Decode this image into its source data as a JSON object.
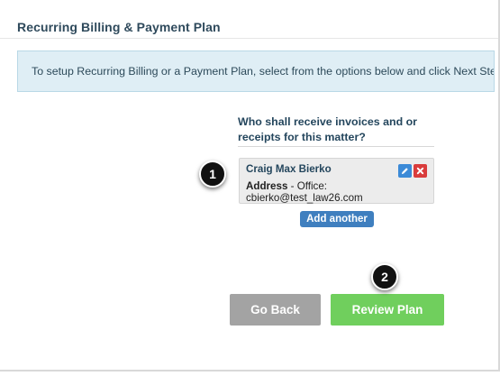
{
  "page": {
    "title": "Recurring Billing & Payment Plan",
    "instructions": "To setup Recurring Billing or a Payment Plan, select from the options below and click Next Step."
  },
  "recipients": {
    "heading": "Who shall receive invoices and or receipts for this matter?",
    "contacts": [
      {
        "name": "Craig Max Bierko",
        "address_label": "Address",
        "address_value": " - Office:",
        "email": "cbierko@test_law26.com",
        "edit_icon": "pencil-icon",
        "delete_icon": "close-icon"
      }
    ],
    "add_label": "Add another"
  },
  "actions": {
    "back_label": "Go Back",
    "review_label": "Review Plan"
  },
  "callouts": [
    "1",
    "2"
  ],
  "colors": {
    "title": "#2f4a5c",
    "banner_bg": "#dfeef5",
    "edit": "#3b8ad7",
    "delete": "#d93c3c",
    "add_button": "#3f7fbf",
    "go_back": "#a3a3a3",
    "review_plan": "#70cf5d"
  }
}
